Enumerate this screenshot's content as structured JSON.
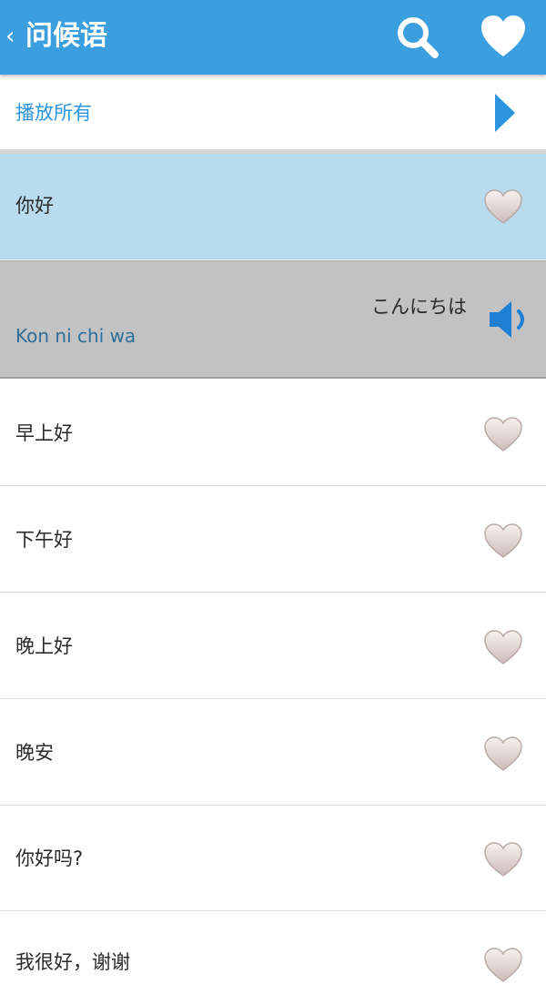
{
  "header": {
    "back_glyph": "‹",
    "title": "问候语",
    "search_icon": "search-icon",
    "favorites_icon": "heart-icon",
    "bar_color": "#3b9ede"
  },
  "play_all": {
    "label": "播放所有",
    "icon": "play-arrow-icon",
    "accent": "#2a95de"
  },
  "phrases": [
    {
      "label": "你好",
      "selected": true
    },
    {
      "label": "早上好"
    },
    {
      "label": "下午好"
    },
    {
      "label": "晚上好"
    },
    {
      "label": "晚安"
    },
    {
      "label": "你好吗?"
    },
    {
      "label": "我很好，谢谢"
    }
  ],
  "detail": {
    "japanese": "こんにちは",
    "romaji": "Kon ni chi wa",
    "speaker_icon": "speaker-icon"
  }
}
